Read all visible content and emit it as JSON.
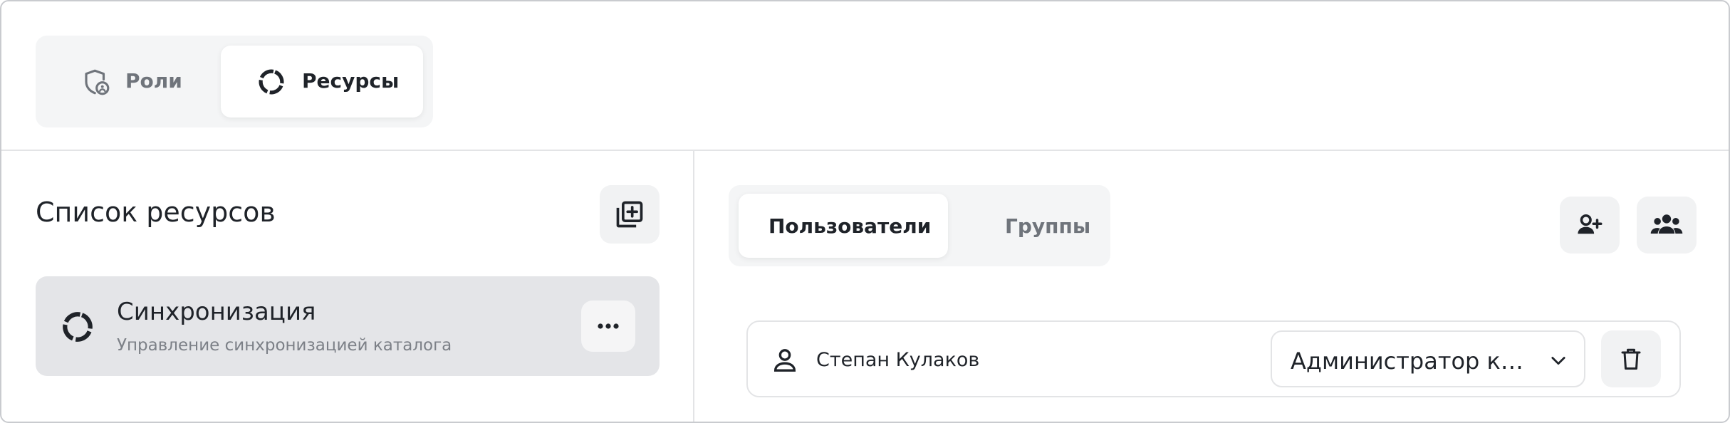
{
  "top_tabs": [
    {
      "label": "Роли",
      "icon": "shield-user-icon",
      "active": false
    },
    {
      "label": "Ресурсы",
      "icon": "ring-icon",
      "active": true
    }
  ],
  "left_panel": {
    "title": "Список ресурсов",
    "add_icon": "add-library-icon",
    "items": [
      {
        "name": "Синхронизация",
        "description": "Управление синхронизацией каталога",
        "icon": "ring-icon",
        "selected": true
      }
    ]
  },
  "right_panel": {
    "tabs": [
      {
        "label": "Пользователи",
        "active": true
      },
      {
        "label": "Группы",
        "active": false
      }
    ],
    "actions": [
      "add-user-icon",
      "add-group-icon"
    ],
    "rows": [
      {
        "name": "Степан Кулаков",
        "role": "Администратор каталога",
        "icon": "user-icon"
      }
    ]
  },
  "colors": {
    "text_primary": "#1f2329",
    "text_muted": "#6f747b",
    "surface": "#f4f5f6",
    "selected": "#e4e5e8",
    "border": "#e3e4e6"
  }
}
